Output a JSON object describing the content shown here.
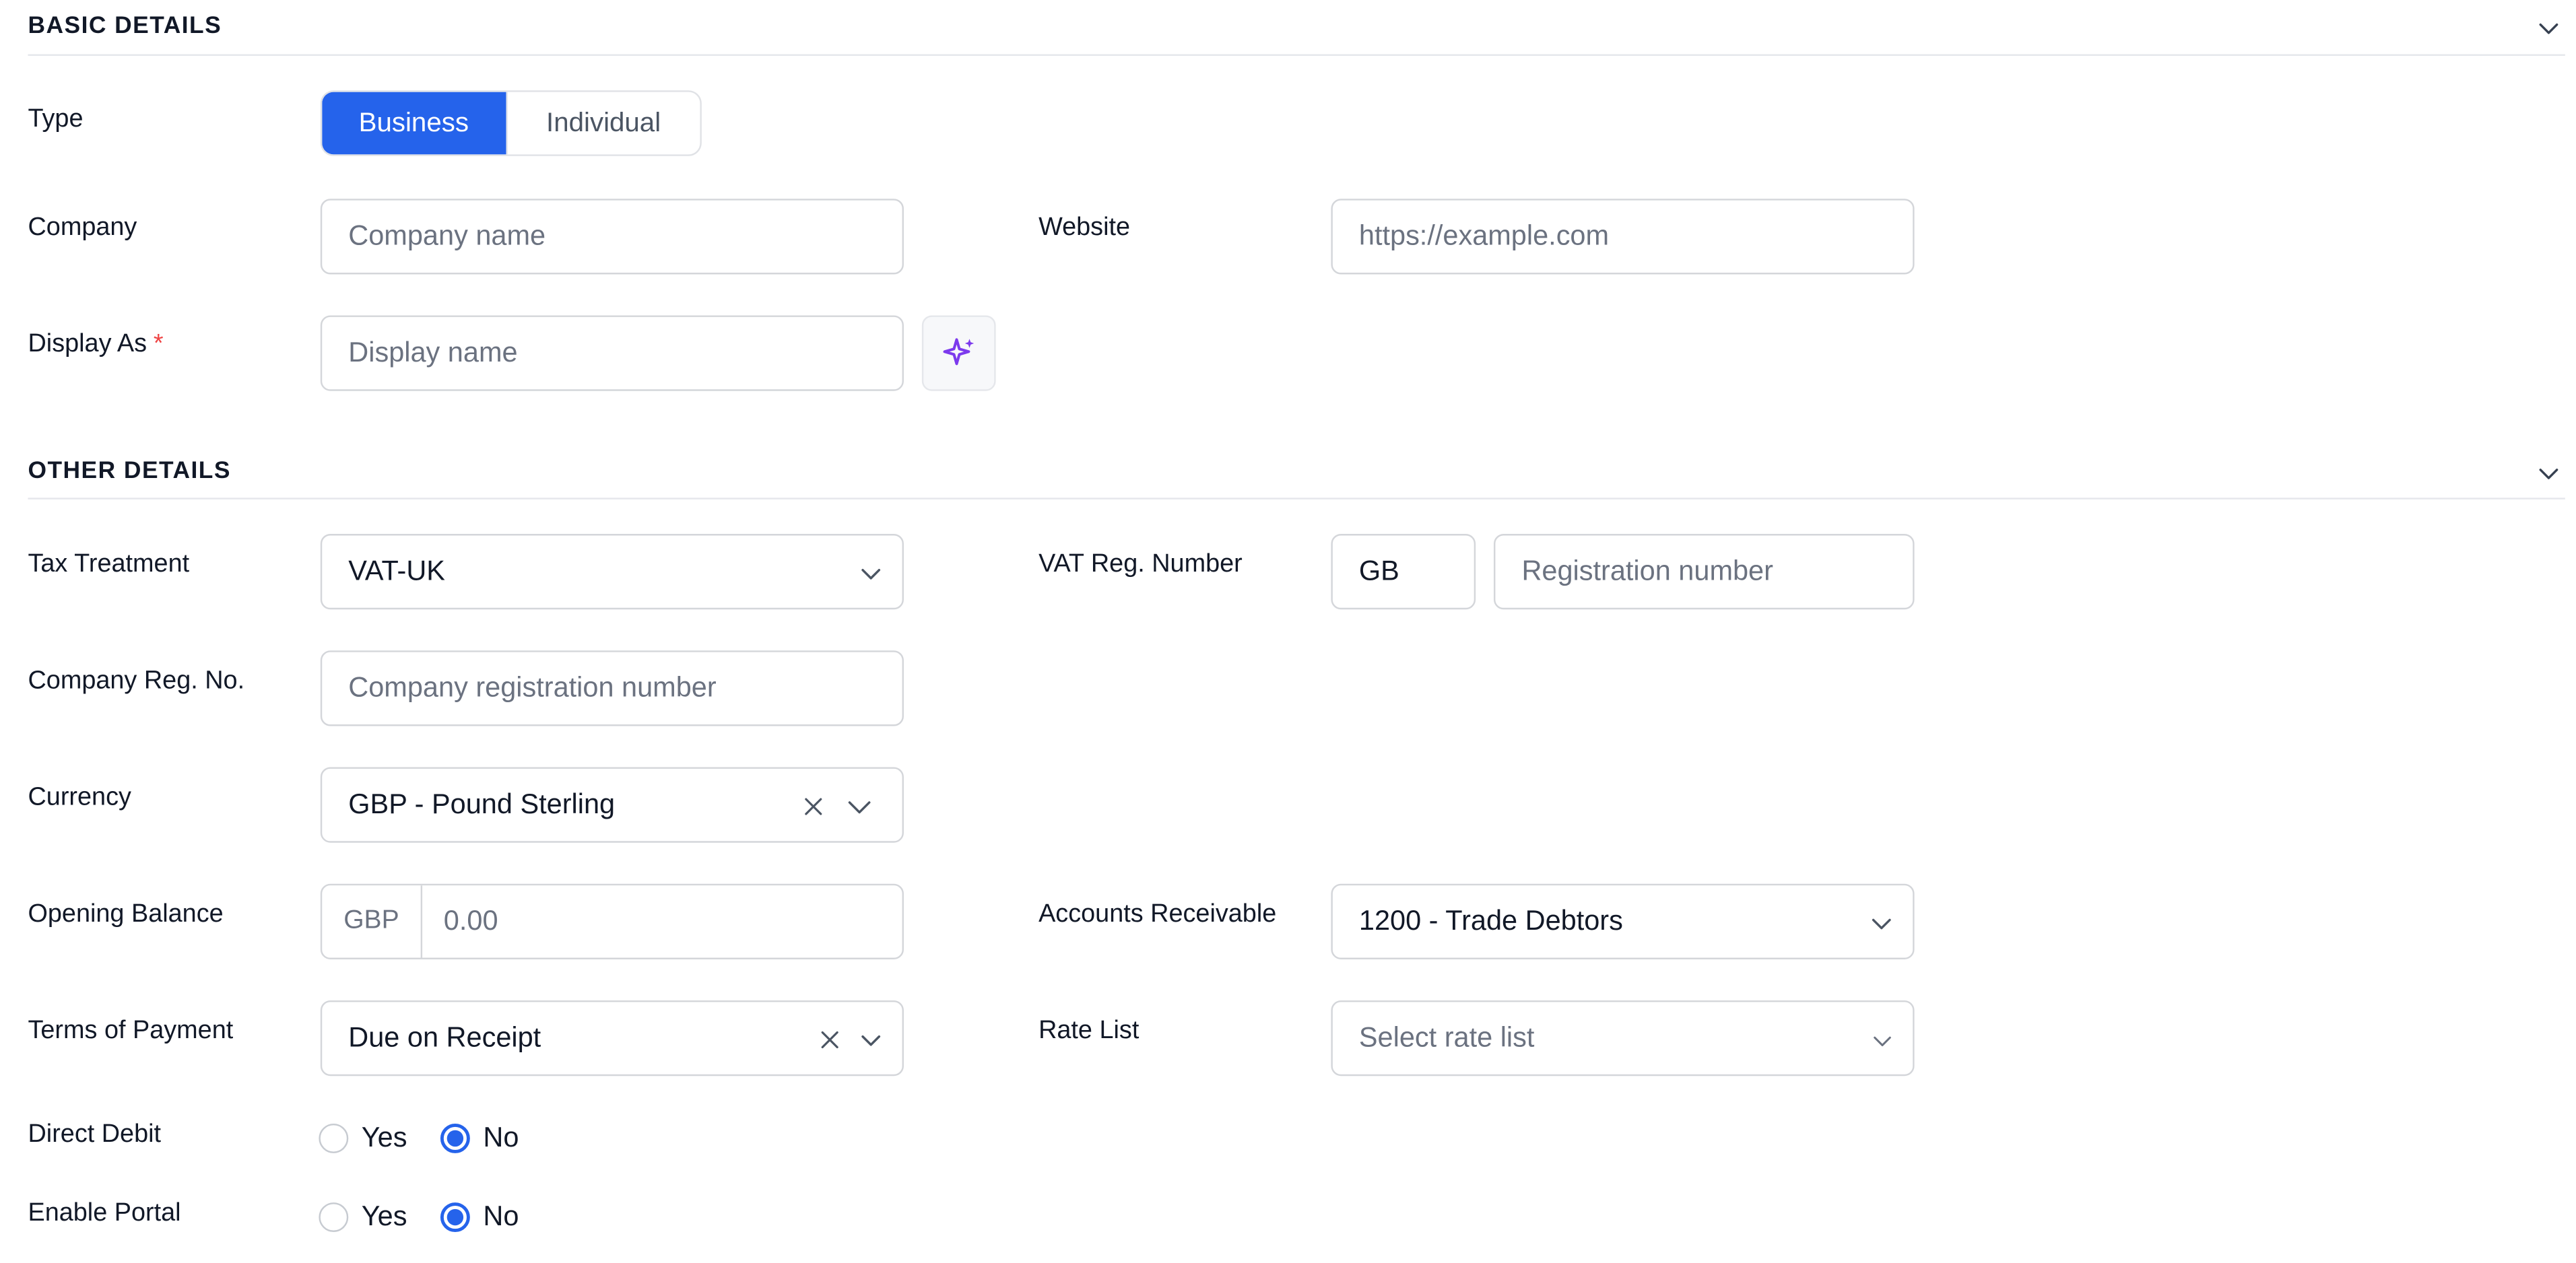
{
  "basic_details": {
    "title": "BASIC DETAILS",
    "type": {
      "label": "Type",
      "options": [
        "Business",
        "Individual"
      ],
      "selected": "Business"
    },
    "company": {
      "label": "Company",
      "placeholder": "Company name"
    },
    "website": {
      "label": "Website",
      "placeholder": "https://example.com"
    },
    "display_as": {
      "label": "Display As",
      "required_mark": "*",
      "placeholder": "Display name",
      "ai_icon": "sparkles-icon"
    }
  },
  "other_details": {
    "title": "OTHER DETAILS",
    "tax_treatment": {
      "label": "Tax Treatment",
      "value": "VAT-UK"
    },
    "vat_reg_number": {
      "label": "VAT Reg. Number",
      "prefix": "GB",
      "placeholder": "Registration number"
    },
    "company_reg_no": {
      "label": "Company Reg. No.",
      "placeholder": "Company registration number"
    },
    "currency": {
      "label": "Currency",
      "value": "GBP - Pound Sterling"
    },
    "opening_balance": {
      "label": "Opening Balance",
      "currency_addon": "GBP",
      "placeholder": "0.00"
    },
    "accounts_receivable": {
      "label": "Accounts Receivable",
      "value": "1200 - Trade Debtors"
    },
    "terms_of_payment": {
      "label": "Terms of Payment",
      "value": "Due on Receipt"
    },
    "rate_list": {
      "label": "Rate List",
      "placeholder": "Select rate list"
    },
    "direct_debit": {
      "label": "Direct Debit",
      "options": [
        "Yes",
        "No"
      ],
      "selected": "No"
    },
    "enable_portal": {
      "label": "Enable Portal",
      "options": [
        "Yes",
        "No"
      ],
      "selected": "No"
    }
  },
  "colors": {
    "accent": "#2563eb",
    "ai_icon": "#7c3aed",
    "required": "#ef4444"
  }
}
